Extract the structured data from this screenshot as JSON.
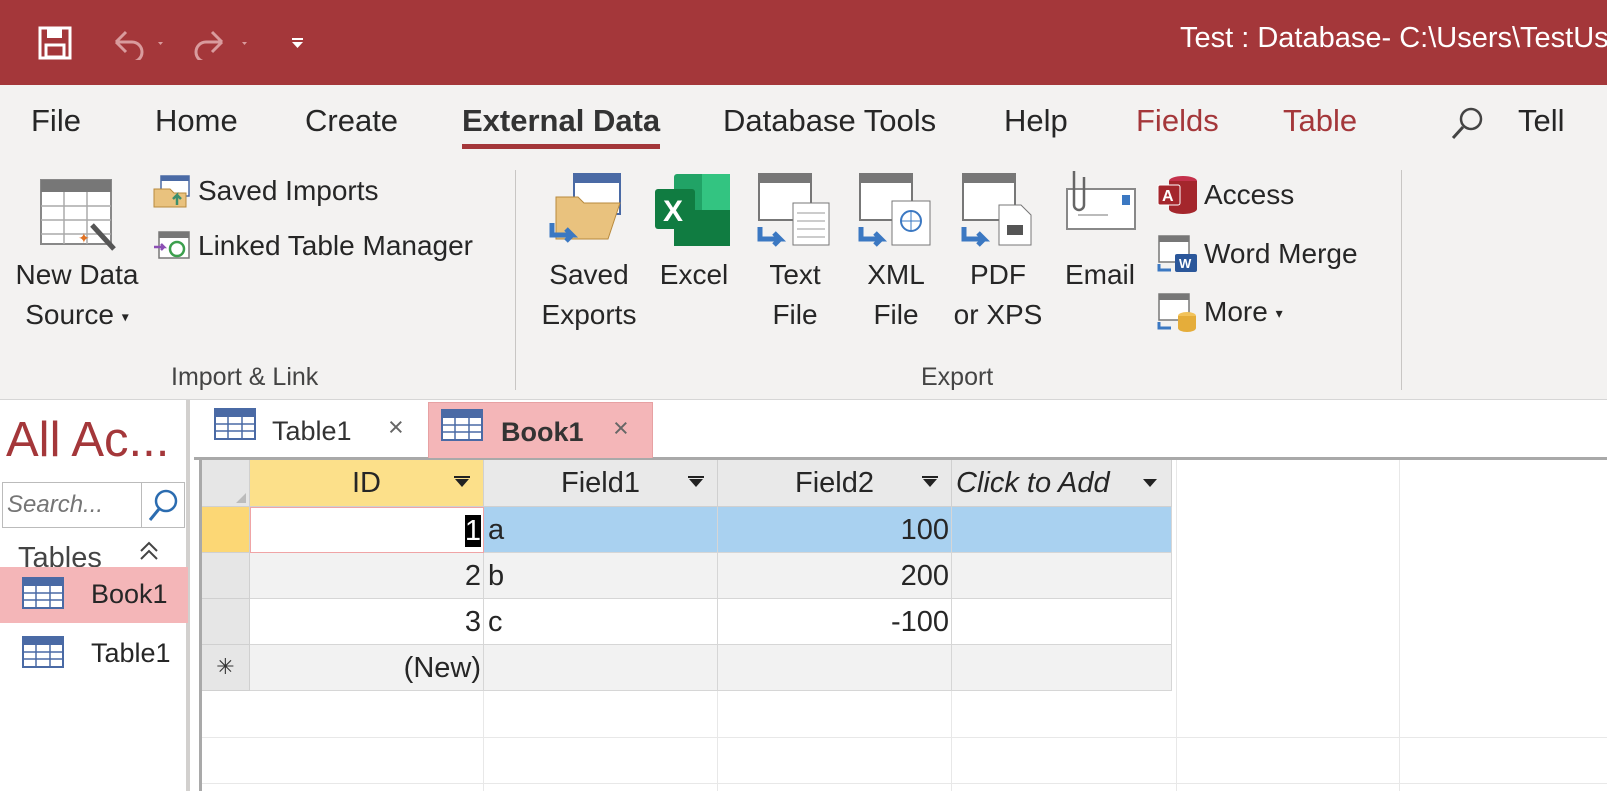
{
  "window": {
    "title": "Test : Database- C:\\Users\\TestUs",
    "brand_color": "#a4373a"
  },
  "ribbon_tabs": [
    {
      "label": "File"
    },
    {
      "label": "Home"
    },
    {
      "label": "Create"
    },
    {
      "label": "External Data",
      "active": true
    },
    {
      "label": "Database Tools"
    },
    {
      "label": "Help"
    },
    {
      "label": "Fields",
      "contextual": true
    },
    {
      "label": "Table",
      "contextual": true
    },
    {
      "label": "Tell"
    }
  ],
  "import_link": {
    "group_label": "Import & Link",
    "new_data_source_line1": "New Data",
    "new_data_source_line2": "Source",
    "saved_imports": "Saved Imports",
    "linked_table_manager": "Linked Table Manager"
  },
  "export": {
    "group_label": "Export",
    "saved_exports_line1": "Saved",
    "saved_exports_line2": "Exports",
    "excel": "Excel",
    "text_file_line1": "Text",
    "text_file_line2": "File",
    "xml_file_line1": "XML",
    "xml_file_line2": "File",
    "pdf_line1": "PDF",
    "pdf_line2": "or XPS",
    "email": "Email",
    "access": "Access",
    "word_merge": "Word Merge",
    "more": "More"
  },
  "nav_pane": {
    "title": "All Ac...",
    "search_placeholder": "Search...",
    "group": "Tables",
    "items": [
      {
        "label": "Book1",
        "selected": true
      },
      {
        "label": "Table1",
        "selected": false
      }
    ]
  },
  "doc_tabs": [
    {
      "label": "Table1",
      "active": false
    },
    {
      "label": "Book1",
      "active": true
    }
  ],
  "datasheet": {
    "columns": [
      "ID",
      "Field1",
      "Field2",
      "Click to Add"
    ],
    "rows": [
      {
        "id": "1",
        "field1": "a",
        "field2": "100"
      },
      {
        "id": "2",
        "field1": "b",
        "field2": "200"
      },
      {
        "id": "3",
        "field1": "c",
        "field2": "-100"
      }
    ],
    "new_row_label": "(New)",
    "new_row_marker": "✳"
  }
}
